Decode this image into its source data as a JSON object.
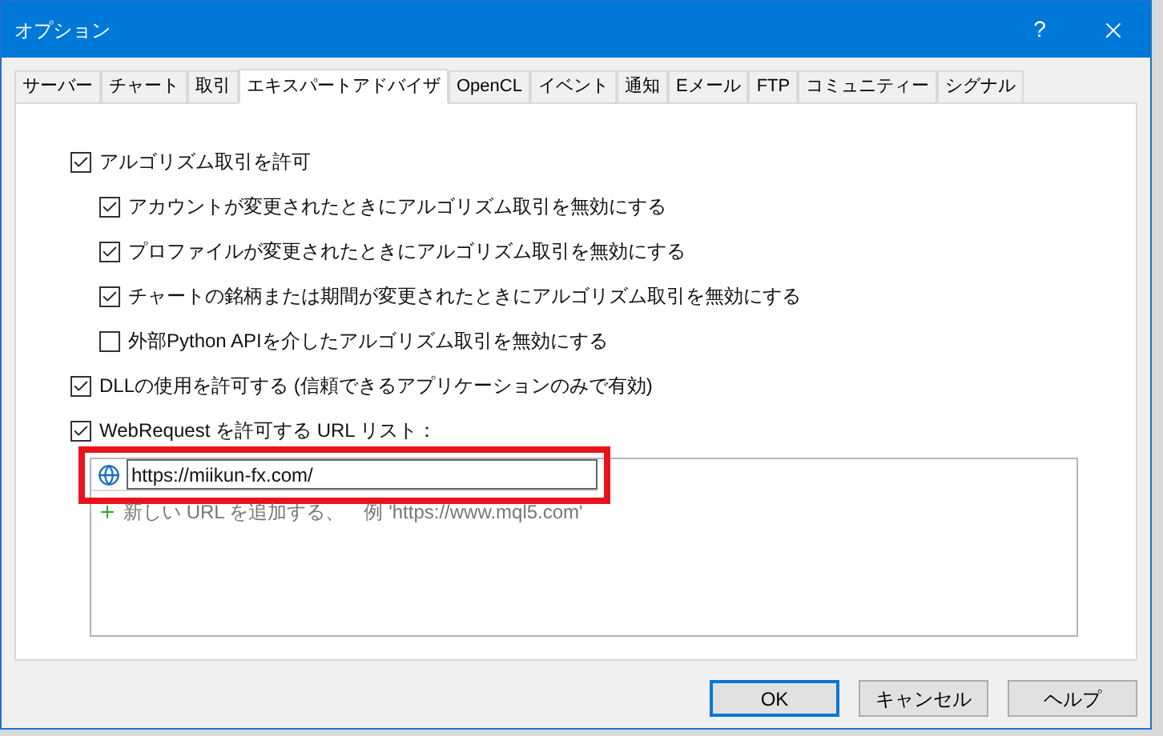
{
  "window": {
    "title": "オプション",
    "help": "?"
  },
  "tabs": [
    {
      "label": "サーバー",
      "selected": false
    },
    {
      "label": "チャート",
      "selected": false
    },
    {
      "label": "取引",
      "selected": false
    },
    {
      "label": "エキスパートアドバイザ",
      "selected": true
    },
    {
      "label": "OpenCL",
      "selected": false
    },
    {
      "label": "イベント",
      "selected": false
    },
    {
      "label": "通知",
      "selected": false
    },
    {
      "label": "Eメール",
      "selected": false
    },
    {
      "label": "FTP",
      "selected": false
    },
    {
      "label": "コミュニティー",
      "selected": false
    },
    {
      "label": "シグナル",
      "selected": false
    }
  ],
  "options": [
    {
      "label": "アルゴリズム取引を許可",
      "checked": true,
      "children": [
        {
          "label": "アカウントが変更されたときにアルゴリズム取引を無効にする",
          "checked": true
        },
        {
          "label": "プロファイルが変更されたときにアルゴリズム取引を無効にする",
          "checked": true
        },
        {
          "label": "チャートの銘柄または期間が変更されたときにアルゴリズム取引を無効にする",
          "checked": true
        },
        {
          "label": "外部Python APIを介したアルゴリズム取引を無効にする",
          "checked": false
        }
      ]
    },
    {
      "label": "DLLの使用を許可する (信頼できるアプリケーションのみで有効)",
      "checked": true
    },
    {
      "label": "WebRequest を許可する URL リスト：",
      "checked": true
    }
  ],
  "url_list": {
    "entries": [
      {
        "value": "https://miikun-fx.com/",
        "highlighted": true
      }
    ],
    "add_hint": "新しい URL を追加する、　例 'https://www.mql5.com'"
  },
  "buttons": [
    {
      "label": "OK",
      "default": true
    },
    {
      "label": "キャンセル",
      "default": false
    },
    {
      "label": "ヘルプ",
      "default": false
    }
  ]
}
